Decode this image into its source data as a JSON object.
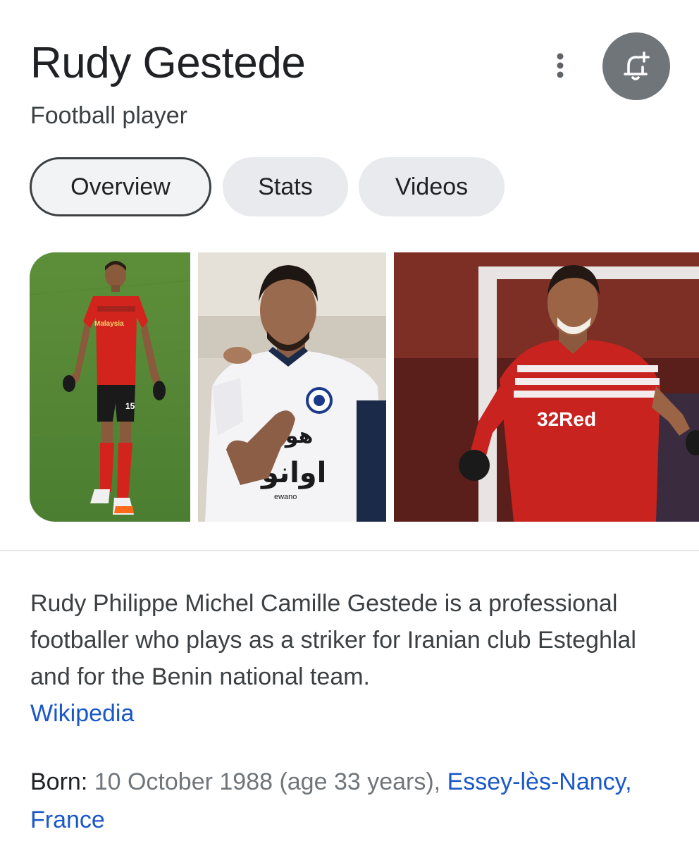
{
  "header": {
    "title": "Rudy Gestede",
    "subtitle": "Football player",
    "more_icon": "more-vert-icon",
    "bell_icon": "notification-add-icon"
  },
  "tabs": [
    {
      "label": "Overview",
      "active": true
    },
    {
      "label": "Stats",
      "active": false
    },
    {
      "label": "Videos",
      "active": false
    }
  ],
  "description": {
    "text": "Rudy Philippe Michel Camille Gestede is a professional footballer who plays as a striker for Iranian club Esteghlal and for the Benin national team.",
    "source_link": "Wikipedia"
  },
  "born": {
    "label": "Born:",
    "value": "10 October 1988 (age 33 years),",
    "place_link": "Essey-lès-Nancy, France"
  },
  "images": {
    "photo1_jersey": "Malaysia",
    "photo1_number": "15",
    "photo3_sponsor": "32Red"
  },
  "colors": {
    "link": "#1a57c9",
    "bell_bg": "#70757a"
  }
}
